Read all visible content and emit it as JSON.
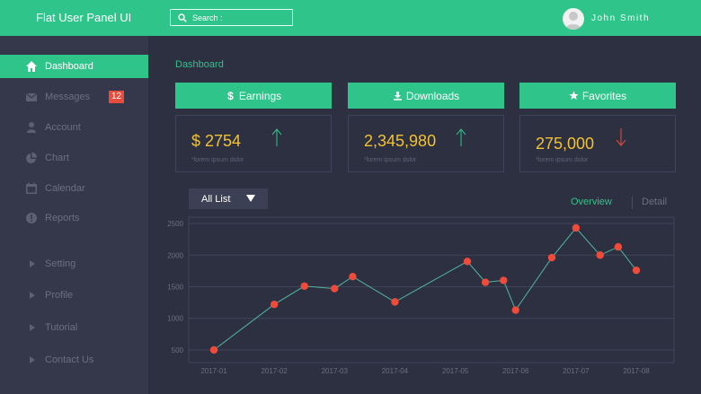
{
  "header": {
    "title": "Flat User Panel UI",
    "search_label": "Search :",
    "user_name": "John Smith"
  },
  "sidebar": {
    "items": [
      {
        "label": "Dashboard",
        "icon": "home-icon",
        "active": true
      },
      {
        "label": "Messages",
        "icon": "envelope-icon",
        "badge": "12"
      },
      {
        "label": "Account",
        "icon": "user-icon"
      },
      {
        "label": "Chart",
        "icon": "pie-chart-icon"
      },
      {
        "label": "Calendar",
        "icon": "calendar-icon"
      },
      {
        "label": "Reports",
        "icon": "warning-icon"
      },
      {
        "label": "Setting",
        "icon": "play-icon"
      },
      {
        "label": "Profile",
        "icon": "play-icon"
      },
      {
        "label": "Tutorial",
        "icon": "play-icon"
      },
      {
        "label": "Contact Us",
        "icon": "play-icon"
      }
    ]
  },
  "main": {
    "page_title": "Dashboard",
    "cards": [
      {
        "label": "Earnings",
        "icon": "dollar-icon",
        "value": "$ 2754",
        "sub": "*lorem ipsum dolor",
        "trend": "up"
      },
      {
        "label": "Downloads",
        "icon": "download-icon",
        "value": "2,345,980",
        "sub": "*lorem ipsum dolor",
        "trend": "up"
      },
      {
        "label": "Favorites",
        "icon": "star-icon",
        "value": "275,000",
        "sub": "*lorem ipsum dolor",
        "trend": "down"
      }
    ],
    "filter_label": "All List",
    "tabs": {
      "overview": "Overview",
      "detail": "Detail"
    }
  },
  "colors": {
    "accent": "#2ec48a",
    "value": "#f3c233",
    "down": "#e74c3c",
    "point": "#f04a3a"
  },
  "chart_data": {
    "type": "line",
    "x_ticks": [
      "2017-01",
      "2017-02",
      "2017-03",
      "2017-04",
      "2017-05",
      "2017-06",
      "2017-07",
      "2017-08"
    ],
    "y_ticks": [
      500,
      1000,
      1500,
      2000,
      2500
    ],
    "ylim": [
      300,
      2600
    ],
    "grid": true,
    "points": [
      {
        "x": 0.0,
        "y": 500
      },
      {
        "x": 1.0,
        "y": 1220
      },
      {
        "x": 1.5,
        "y": 1510
      },
      {
        "x": 2.0,
        "y": 1470
      },
      {
        "x": 2.3,
        "y": 1660
      },
      {
        "x": 3.0,
        "y": 1260
      },
      {
        "x": 4.2,
        "y": 1900
      },
      {
        "x": 4.5,
        "y": 1570
      },
      {
        "x": 4.8,
        "y": 1600
      },
      {
        "x": 5.0,
        "y": 1130
      },
      {
        "x": 5.6,
        "y": 1960
      },
      {
        "x": 6.0,
        "y": 2430
      },
      {
        "x": 6.4,
        "y": 2000
      },
      {
        "x": 6.7,
        "y": 2130
      },
      {
        "x": 7.0,
        "y": 1760
      }
    ]
  }
}
